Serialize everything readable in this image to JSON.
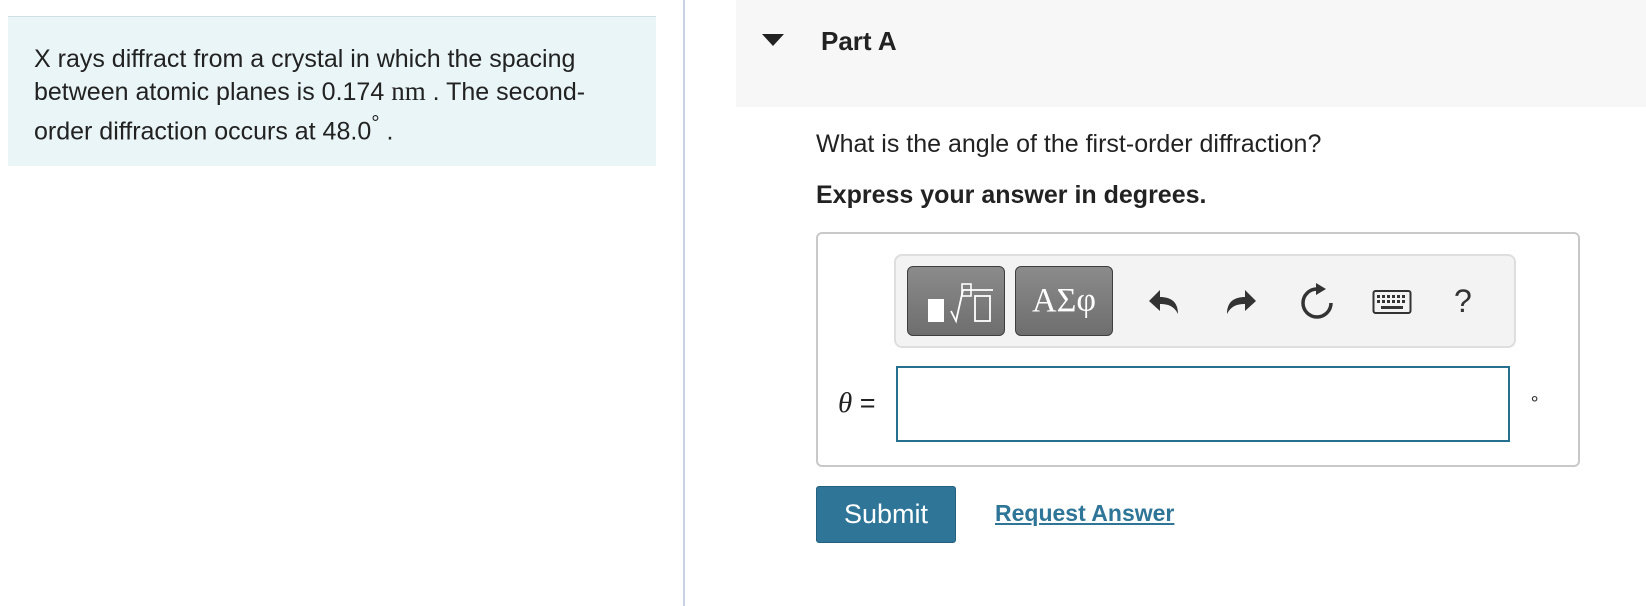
{
  "problem": {
    "text_part1": "X rays diffract from a crystal in which the spacing between atomic planes is 0.174",
    "unit_nm": "nm",
    "text_part2": ". The second-order diffraction occurs at 48.0",
    "degree_symbol": "°",
    "text_part3": "."
  },
  "part": {
    "title": "Part A",
    "question": "What is the angle of the first-order diffraction?",
    "instruction": "Express your answer in degrees."
  },
  "toolbar": {
    "greek_label": "ΑΣφ",
    "help_label": "?"
  },
  "answer": {
    "variable_symbol": "θ",
    "equals": "=",
    "value": "",
    "unit": "∘"
  },
  "actions": {
    "submit_label": "Submit",
    "request_answer_label": "Request Answer"
  },
  "colors": {
    "problem_bg": "#e9f5f6",
    "accent": "#2e7597",
    "toolbar_button": "#7a7a7a"
  }
}
